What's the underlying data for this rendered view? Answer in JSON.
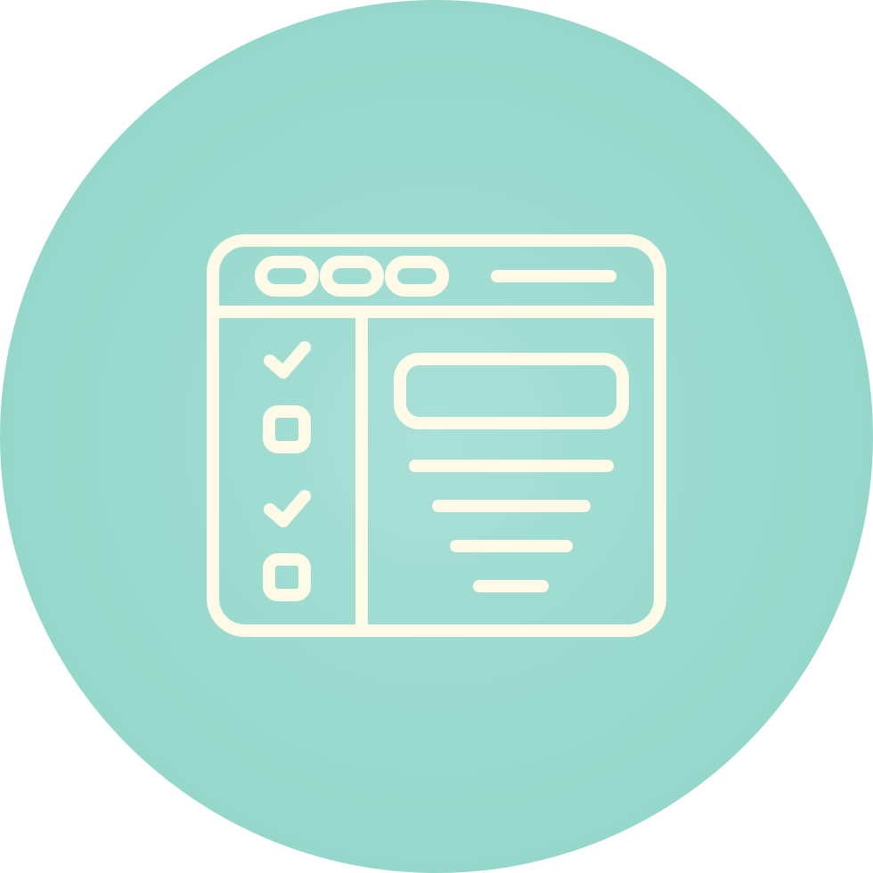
{
  "icon": {
    "name": "browser-checklist-icon",
    "colors": {
      "badge": "#9bdacf",
      "stroke": "#fdfbe8"
    },
    "checklist_items": [
      {
        "name": "checklist-item-1",
        "state": "checked"
      },
      {
        "name": "checklist-item-2",
        "state": "unchecked"
      },
      {
        "name": "checklist-item-3",
        "state": "checked"
      },
      {
        "name": "checklist-item-4",
        "state": "unchecked"
      }
    ]
  }
}
